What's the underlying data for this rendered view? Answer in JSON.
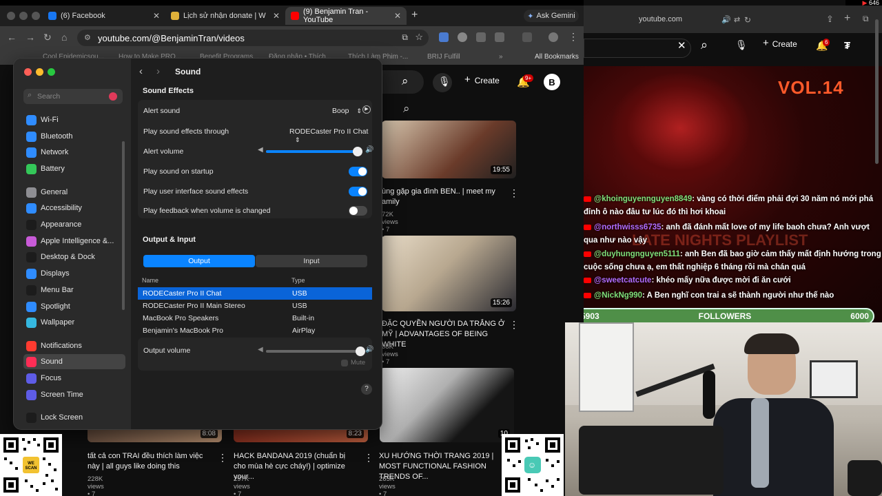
{
  "menubar": {
    "battery_count": "646"
  },
  "chrome": {
    "tabs": [
      {
        "label": "(6) Facebook",
        "color": "#1877f2"
      },
      {
        "label": "Lịch sử nhận donate | WeScan",
        "color": "#e0b13a"
      },
      {
        "label": "(9) Benjamin Tran - YouTube",
        "color": "#ff0000"
      }
    ],
    "new_tab": "+",
    "gemini": "Ask Gemini",
    "url": "youtube.com/@BenjaminTran/videos",
    "bookmarks": [
      "Cool Epidemicsou...",
      "How to Make PRO...",
      "Benefit Programs...",
      "Đăng nhập • Thích...",
      "Thích Làm Phim -...",
      "BRIJ Fulfill",
      "All Bookmarks"
    ],
    "more_bookmarks": "»"
  },
  "youtube": {
    "create_label": "Create",
    "notif_count": "9+",
    "avatar": "B",
    "videos": [
      {
        "title": "ùng gặp gia đình BEN.. | meet my amily",
        "meta": "72K views • 7 years ago",
        "duration": "19:55"
      },
      {
        "title": "ĐẶC QUYỀN NGƯỜI DA TRẮNG Ở MỸ | ADVANTAGES OF BEING WHITE",
        "meta": "08K views • 7 years ago",
        "duration": "15:26"
      },
      {
        "title": "tất cả con TRAI đều thích làm việc này | all guys like doing this",
        "meta": "228K views • 7 years ago",
        "duration": "8:08"
      },
      {
        "title": "HACK BANDANA 2019 (chuẩn bị cho mùa hè cực cháy!) | optimize your...",
        "meta": "297K views • 7 years ago",
        "duration": "8:23"
      },
      {
        "title": "XU HƯỚNG THỜI TRANG 2019 | MOST FUNCTIONAL FASHION TRENDS OF...",
        "meta": "265K views • 7 years ago",
        "duration": "10"
      }
    ]
  },
  "settings": {
    "title": "Sound",
    "search_placeholder": "Search",
    "sidebar": [
      {
        "label": "Wi-Fi",
        "color": "#2f8cff",
        "icon": "wifi-icon"
      },
      {
        "label": "Bluetooth",
        "color": "#2f8cff",
        "icon": "bluetooth-icon"
      },
      {
        "label": "Network",
        "color": "#2f8cff",
        "icon": "globe-icon"
      },
      {
        "label": "Battery",
        "color": "#34c759",
        "icon": "battery-icon"
      },
      {
        "label": "General",
        "color": "#8e8e93",
        "icon": "gear-icon"
      },
      {
        "label": "Accessibility",
        "color": "#2f8cff",
        "icon": "accessibility-icon"
      },
      {
        "label": "Appearance",
        "color": "#1c1c1c",
        "icon": "appearance-icon"
      },
      {
        "label": "Apple Intelligence &...",
        "color": "#c85bd8",
        "icon": "apple-intelligence-icon"
      },
      {
        "label": "Desktop & Dock",
        "color": "#1c1c1c",
        "icon": "dock-icon"
      },
      {
        "label": "Displays",
        "color": "#2f8cff",
        "icon": "display-icon"
      },
      {
        "label": "Menu Bar",
        "color": "#1c1c1c",
        "icon": "menubar-icon"
      },
      {
        "label": "Spotlight",
        "color": "#2f8cff",
        "icon": "spotlight-icon"
      },
      {
        "label": "Wallpaper",
        "color": "#35b8e0",
        "icon": "wallpaper-icon"
      },
      {
        "label": "Notifications",
        "color": "#ff3b30",
        "icon": "bell-icon"
      },
      {
        "label": "Sound",
        "color": "#ff2d55",
        "icon": "speaker-icon"
      },
      {
        "label": "Focus",
        "color": "#5e5ce6",
        "icon": "moon-icon"
      },
      {
        "label": "Screen Time",
        "color": "#5e5ce6",
        "icon": "hourglass-icon"
      },
      {
        "label": "Lock Screen",
        "color": "#1c1c1c",
        "icon": "lock-icon"
      }
    ],
    "sound_effects": {
      "heading": "Sound Effects",
      "alert_sound_label": "Alert sound",
      "alert_sound_value": "Boop",
      "play_through_label": "Play sound effects through",
      "play_through_value": "RODECaster Pro II Chat",
      "alert_volume_label": "Alert volume",
      "alert_volume_level": 0.95,
      "startup_label": "Play sound on startup",
      "startup_on": true,
      "ui_sounds_label": "Play user interface sound effects",
      "ui_sounds_on": true,
      "feedback_label": "Play feedback when volume is changed",
      "feedback_on": false
    },
    "output_input": {
      "heading": "Output & Input",
      "tab_output": "Output",
      "tab_input": "Input",
      "col_name": "Name",
      "col_type": "Type",
      "devices": [
        {
          "name": "RODECaster Pro II Chat",
          "type": "USB",
          "selected": true
        },
        {
          "name": "RODECaster Pro II Main Stereo",
          "type": "USB",
          "selected": false
        },
        {
          "name": "MacBook Pro Speakers",
          "type": "Built-in",
          "selected": false
        },
        {
          "name": "Benjamin's MacBook Pro",
          "type": "AirPlay",
          "selected": false
        }
      ],
      "output_volume_label": "Output volume",
      "output_volume_level": 0.98,
      "mute_label": "Mute",
      "help": "?"
    }
  },
  "safari": {
    "address": "youtube.com",
    "create_label": "Create",
    "notif_count": "6"
  },
  "stream": {
    "vol_label": "VOL.14",
    "playlist_text": "LATE NIGHTS PLAYLIST",
    "chat": [
      {
        "user": "@khoinguyennguyen8849",
        "msg": ": vàng có thời điểm phải đợi 30 năm nó mới phá đỉnh ô nào đâu tư lúc đó thì hơi khoai",
        "color": "#7fe07a"
      },
      {
        "user": "@northwisss6735",
        "msg": ": anh đã đánh mất love of my life baoh chưa? Anh vượt qua như nào vậy",
        "color": "#b06cff"
      },
      {
        "user": "@duyhungnguyen5111",
        "msg": ": anh Ben đã bao giờ cảm thấy mất định hướng trong cuộc sống chưa ạ, em thất nghiệp 6 tháng rồi mà chán quá",
        "color": "#7fe07a"
      },
      {
        "user": "@sweetcatcute",
        "msg": ": khéo mấy nữa được mời đi ăn cưới",
        "color": "#b06cff"
      },
      {
        "user": "@NickNg990",
        "msg": ": A Ben nghĩ con trai a sẽ thành người như thế nào",
        "color": "#7fe07a"
      }
    ],
    "followers_current": "5903",
    "followers_label": "FOLLOWERS",
    "followers_goal": "6000",
    "followers_progress": 0.984
  },
  "qr_left_label": "WE SCAN"
}
